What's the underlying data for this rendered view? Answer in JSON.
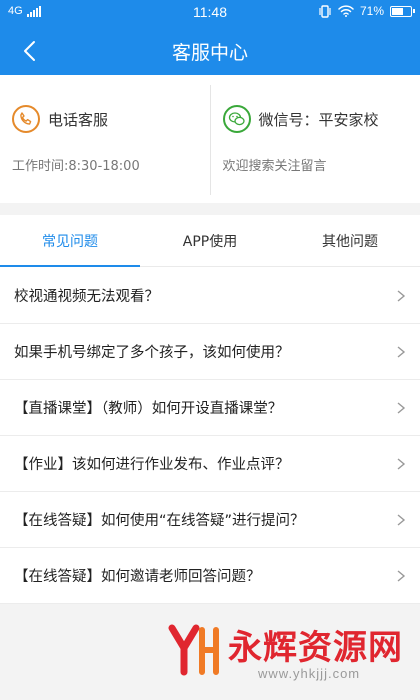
{
  "status_bar": {
    "network": "4G",
    "time": "11:48",
    "battery": "71%",
    "battery_level": 0.71
  },
  "header": {
    "title": "客服中心",
    "color": "#1e8bea"
  },
  "contact": {
    "phone": {
      "label": "电话客服",
      "hours": "工作时间:8:30-18:00",
      "icon": "phone-icon",
      "color": "#e58a2b"
    },
    "wechat": {
      "label": "微信号：平安家校",
      "note": "欢迎搜索关注留言",
      "icon": "wechat-icon",
      "color": "#3aa83a"
    }
  },
  "tabs": [
    {
      "label": "常见问题",
      "active": true
    },
    {
      "label": "APP使用",
      "active": false
    },
    {
      "label": "其他问题",
      "active": false
    }
  ],
  "faq": [
    {
      "question": "校视通视频无法观看？"
    },
    {
      "question": "如果手机号绑定了多个孩子，该如何使用？"
    },
    {
      "question": "【直播课堂】（教师）如何开设直播课堂？"
    },
    {
      "question": "【作业】该如何进行作业发布、作业点评？"
    },
    {
      "question": "【在线答疑】如何使用“在线答疑”进行提问？"
    },
    {
      "question": "【在线答疑】如何邀请老师回答问题？"
    }
  ],
  "watermark": {
    "text": "永辉资源网",
    "url": "www.yhkjjj.com",
    "color": "#e0262f"
  }
}
